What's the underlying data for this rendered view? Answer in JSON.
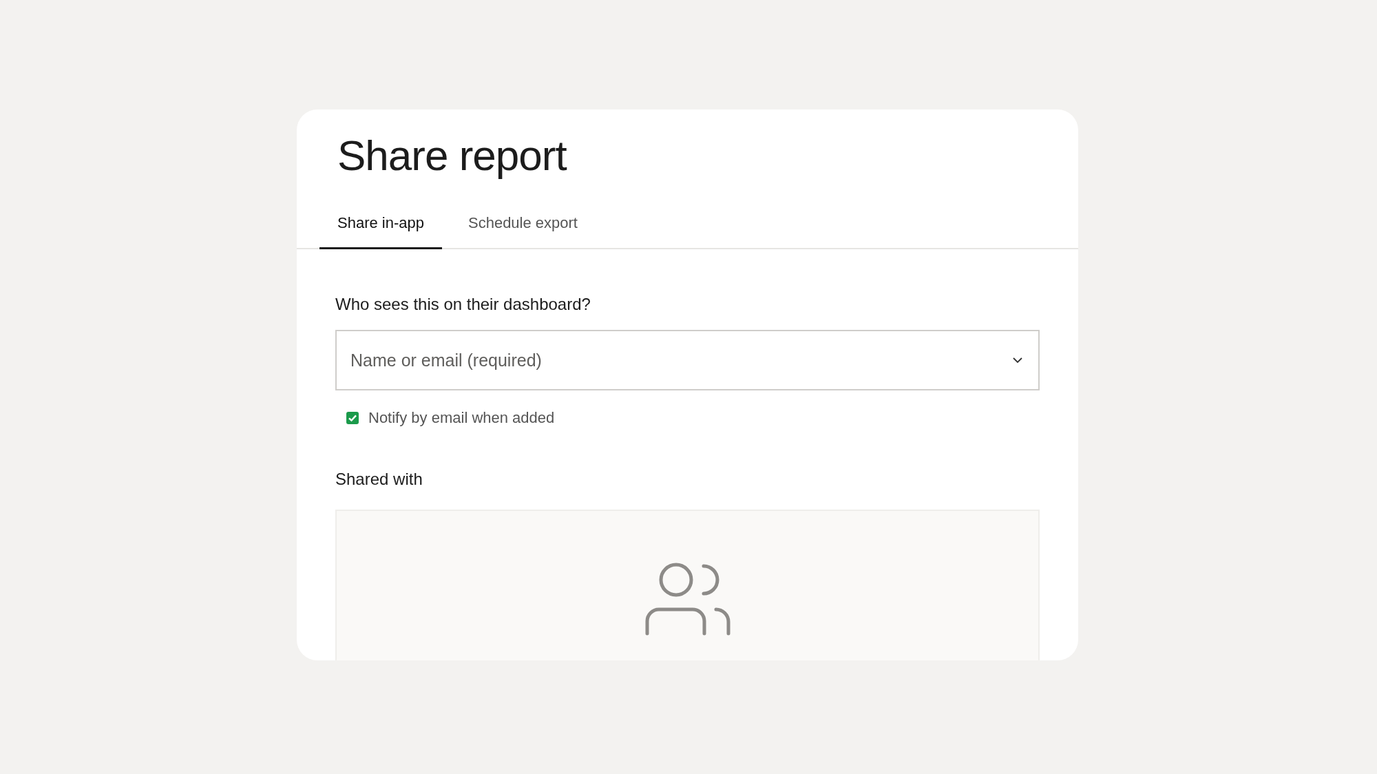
{
  "dialog": {
    "title": "Share report"
  },
  "tabs": [
    {
      "label": "Share in-app",
      "selected": true
    },
    {
      "label": "Schedule export",
      "selected": false
    }
  ],
  "recipients": {
    "label": "Who sees this on their dashboard?",
    "placeholder": "Name or email (required)"
  },
  "notify": {
    "label": "Notify by email when added",
    "checked": true
  },
  "shared_with": {
    "heading": "Shared with"
  }
}
